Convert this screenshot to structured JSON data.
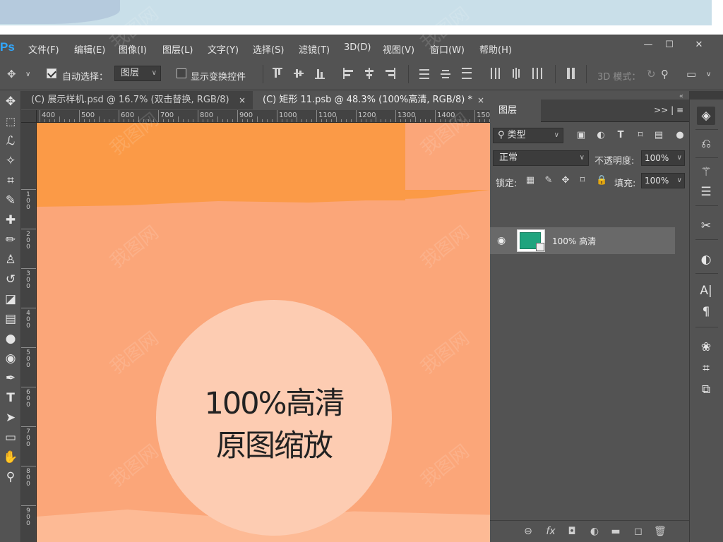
{
  "app": {
    "logo": "Ps"
  },
  "menu": [
    "文件(F)",
    "编辑(E)",
    "图像(I)",
    "图层(L)",
    "文字(Y)",
    "选择(S)",
    "滤镜(T)",
    "3D(D)",
    "视图(V)",
    "窗口(W)",
    "帮助(H)"
  ],
  "window_controls": {
    "minimize": "—",
    "restore": "☐",
    "close": "✕"
  },
  "options": {
    "auto_select_label": "自动选择：",
    "auto_select_checked": true,
    "target_value": "图层",
    "show_transform_label": "显示变换控件",
    "mode_3d_label": "3D 模式："
  },
  "tabs": [
    {
      "label": "(C) 展示样机.psd @ 16.7% (双击替换, RGB/8)",
      "close": "×"
    },
    {
      "label": "(C) 矩形 11.psb @ 48.3% (100%高清, RGB/8) *",
      "close": "×"
    }
  ],
  "ruler": {
    "h_ticks": [
      "400",
      "500",
      "600",
      "700",
      "800",
      "900",
      "1000",
      "1100",
      "1200",
      "1300",
      "1400",
      "1500"
    ],
    "v_ticks": [
      "1\n0\n0",
      "2\n0\n0",
      "3\n0\n0",
      "4\n0\n0",
      "5\n0\n0",
      "6\n0\n0",
      "7\n0\n0",
      "8\n0\n0",
      "9\n0\n0"
    ]
  },
  "canvas": {
    "line1": "100%高清",
    "line2": "原图缩放",
    "bg_color": "#fba679",
    "accent_color": "#fb9a47",
    "badge_color": "#fdccb2"
  },
  "layers_panel": {
    "tab_label": "图层",
    "menu_glyphs": ">> | ≡",
    "filter_label": "类型",
    "blend_mode": "正常",
    "opacity_label": "不透明度:",
    "opacity_value": "100%",
    "lock_label": "锁定:",
    "fill_label": "填充:",
    "fill_value": "100%",
    "layer": {
      "name": "100% 高清",
      "thumb_color": "#1fa47e"
    }
  },
  "watermark": "我图网"
}
